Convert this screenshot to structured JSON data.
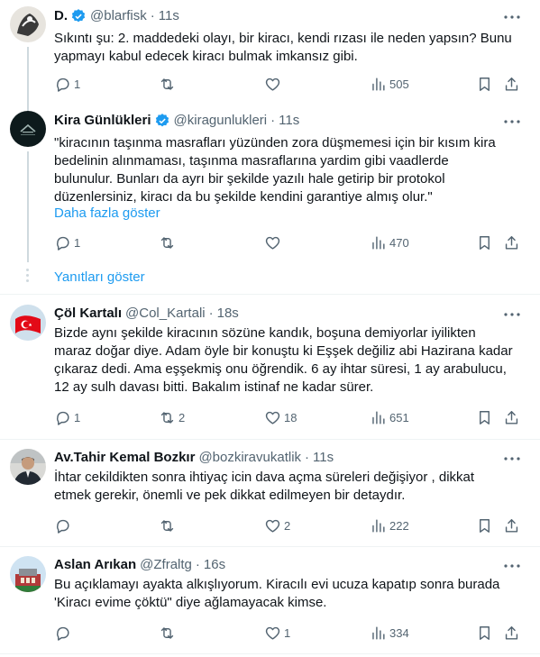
{
  "tweets": [
    {
      "name": "D.",
      "verified": true,
      "handle": "@blarfisk",
      "time": "11s",
      "text": "Sıkıntı şu: 2. maddedeki olayı, bir kiracı, kendi rızası ile neden yapsın? Bunu\nyapmayı kabul edecek kiracı bulmak imkansız gibi.",
      "replies": "1",
      "retweets": "",
      "likes": "",
      "views": "505"
    },
    {
      "name": "Kira Günlükleri",
      "verified": true,
      "handle": "@kiragunlukleri",
      "time": "11s",
      "text": "\"kiracının taşınma masrafları yüzünden zora düşmemesi için bir kısım kira\nbedelinin alınmaması, taşınma masraflarına yardim gibi vaadlerde\nbulunulur. Bunları da ayrı bir şekilde yazılı hale getirip bir protokol\ndüzenlersiniz, kiracı da bu şekilde kendini garantiye almış olur.\"",
      "show_more": "Daha fazla göster",
      "replies": "1",
      "retweets": "",
      "likes": "",
      "views": "470"
    },
    {
      "name": "Çöl Kartalı",
      "verified": false,
      "handle": "@Col_Kartali",
      "time": "18s",
      "text": "Bizde aynı şekilde kiracının sözüne kandık, boşuna demiyorlar iyilikten\nmaraz doğar diye. Adam öyle bir konuştu ki Eşşek değiliz abi Hazirana kadar\nçıkaraz dedi. Ama eşşekmiş onu öğrendik. 6 ay ihtar süresi, 1 ay arabulucu,\n12 ay sulh davası bitti. Bakalım istinaf ne kadar sürer.",
      "replies": "1",
      "retweets": "2",
      "likes": "18",
      "views": "651"
    },
    {
      "name": "Av.Tahir Kemal Bozkır",
      "verified": false,
      "handle": "@bozkiravukatlik",
      "time": "11s",
      "text": "İhtar cekildikten sonra ihtiyaç icin dava açma süreleri değişiyor , dikkat\netmek gerekir, önemli ve pek dikkat edilmeyen bir detaydır.",
      "replies": "",
      "retweets": "",
      "likes": "2",
      "views": "222"
    },
    {
      "name": "Aslan Arıkan",
      "verified": false,
      "handle": "@Zfraltg",
      "time": "16s",
      "text": "Bu açıklamayı ayakta alkışlıyorum. Kiracılı evi ucuza kapatıp sonra burada\n'Kiracı evime çöktü\" diye ağlamayacak kimse.",
      "replies": "",
      "retweets": "",
      "likes": "1",
      "views": "334"
    }
  ],
  "show_replies": "Yanıtları göster",
  "colors": {
    "accent": "#1d9bf0",
    "secondary_text": "#536471",
    "divider": "#eff3f4"
  }
}
